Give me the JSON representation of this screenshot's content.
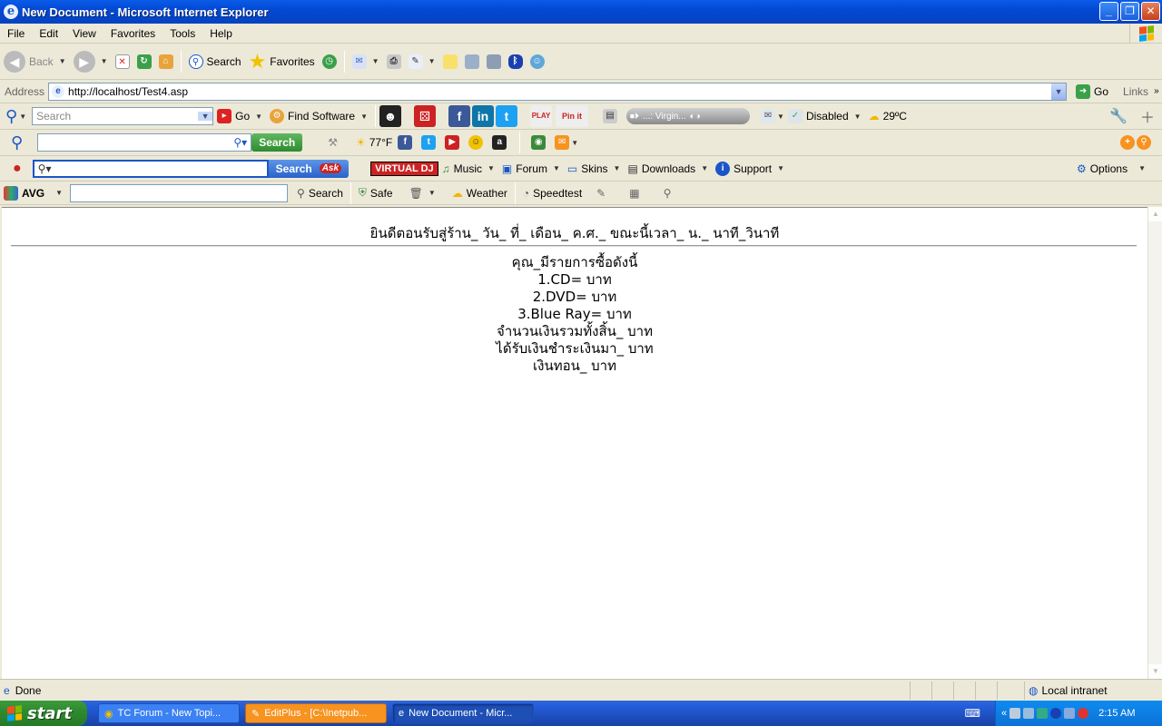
{
  "window": {
    "title": "New Document - Microsoft Internet Explorer",
    "controls": [
      "_",
      "❐",
      "✕"
    ]
  },
  "menu": [
    "File",
    "Edit",
    "View",
    "Favorites",
    "Tools",
    "Help"
  ],
  "toolbar": {
    "back": "Back",
    "search": "Search",
    "favorites": "Favorites"
  },
  "address": {
    "label": "Address",
    "url": "http://localhost/Test4.asp",
    "go": "Go",
    "links": "Links"
  },
  "toolbar2": {
    "search_placeholder": "Search",
    "go": "Go",
    "find_software": "Find Software",
    "player": "...: Virgin...",
    "disabled": "Disabled",
    "weather": "29ºC"
  },
  "toolbar3": {
    "search_button": "Search",
    "temp": "77°F"
  },
  "toolbar4": {
    "search_button": "Search",
    "vdj": "VIRTUAL DJ",
    "music": "Music",
    "forum": "Forum",
    "skins": "Skins",
    "downloads": "Downloads",
    "support": "Support",
    "options": "Options"
  },
  "toolbar5": {
    "avg": "AVG",
    "search": "Search",
    "safe": "Safe",
    "weather": "Weather",
    "speedtest": "Speedtest"
  },
  "page": {
    "welcome": "ยินดีตอนรับสู่ร้าน_ วัน_ ที่_ เดือน_ ค.ศ._ ขณะนี้เวลา_ น._ นาที_วินาที",
    "lines": [
      "คุณ_มีรายการซื้อดังนี้",
      "1.CD=  บาท",
      "2.DVD=  บาท",
      "3.Blue Ray=  บาท",
      "จำนวนเงินรวมทั้งสิ้น_ บาท",
      "ได้รับเงินชำระเงินมา_ บาท",
      "เงินทอน_ บาท"
    ]
  },
  "status": {
    "text": "Done",
    "zone": "Local intranet"
  },
  "taskbar": {
    "start": "start",
    "tasks": [
      "TC Forum - New Topi...",
      "EditPlus - [C:\\Inetpub...",
      "New Document - Micr..."
    ],
    "clock": "2:15 AM"
  }
}
